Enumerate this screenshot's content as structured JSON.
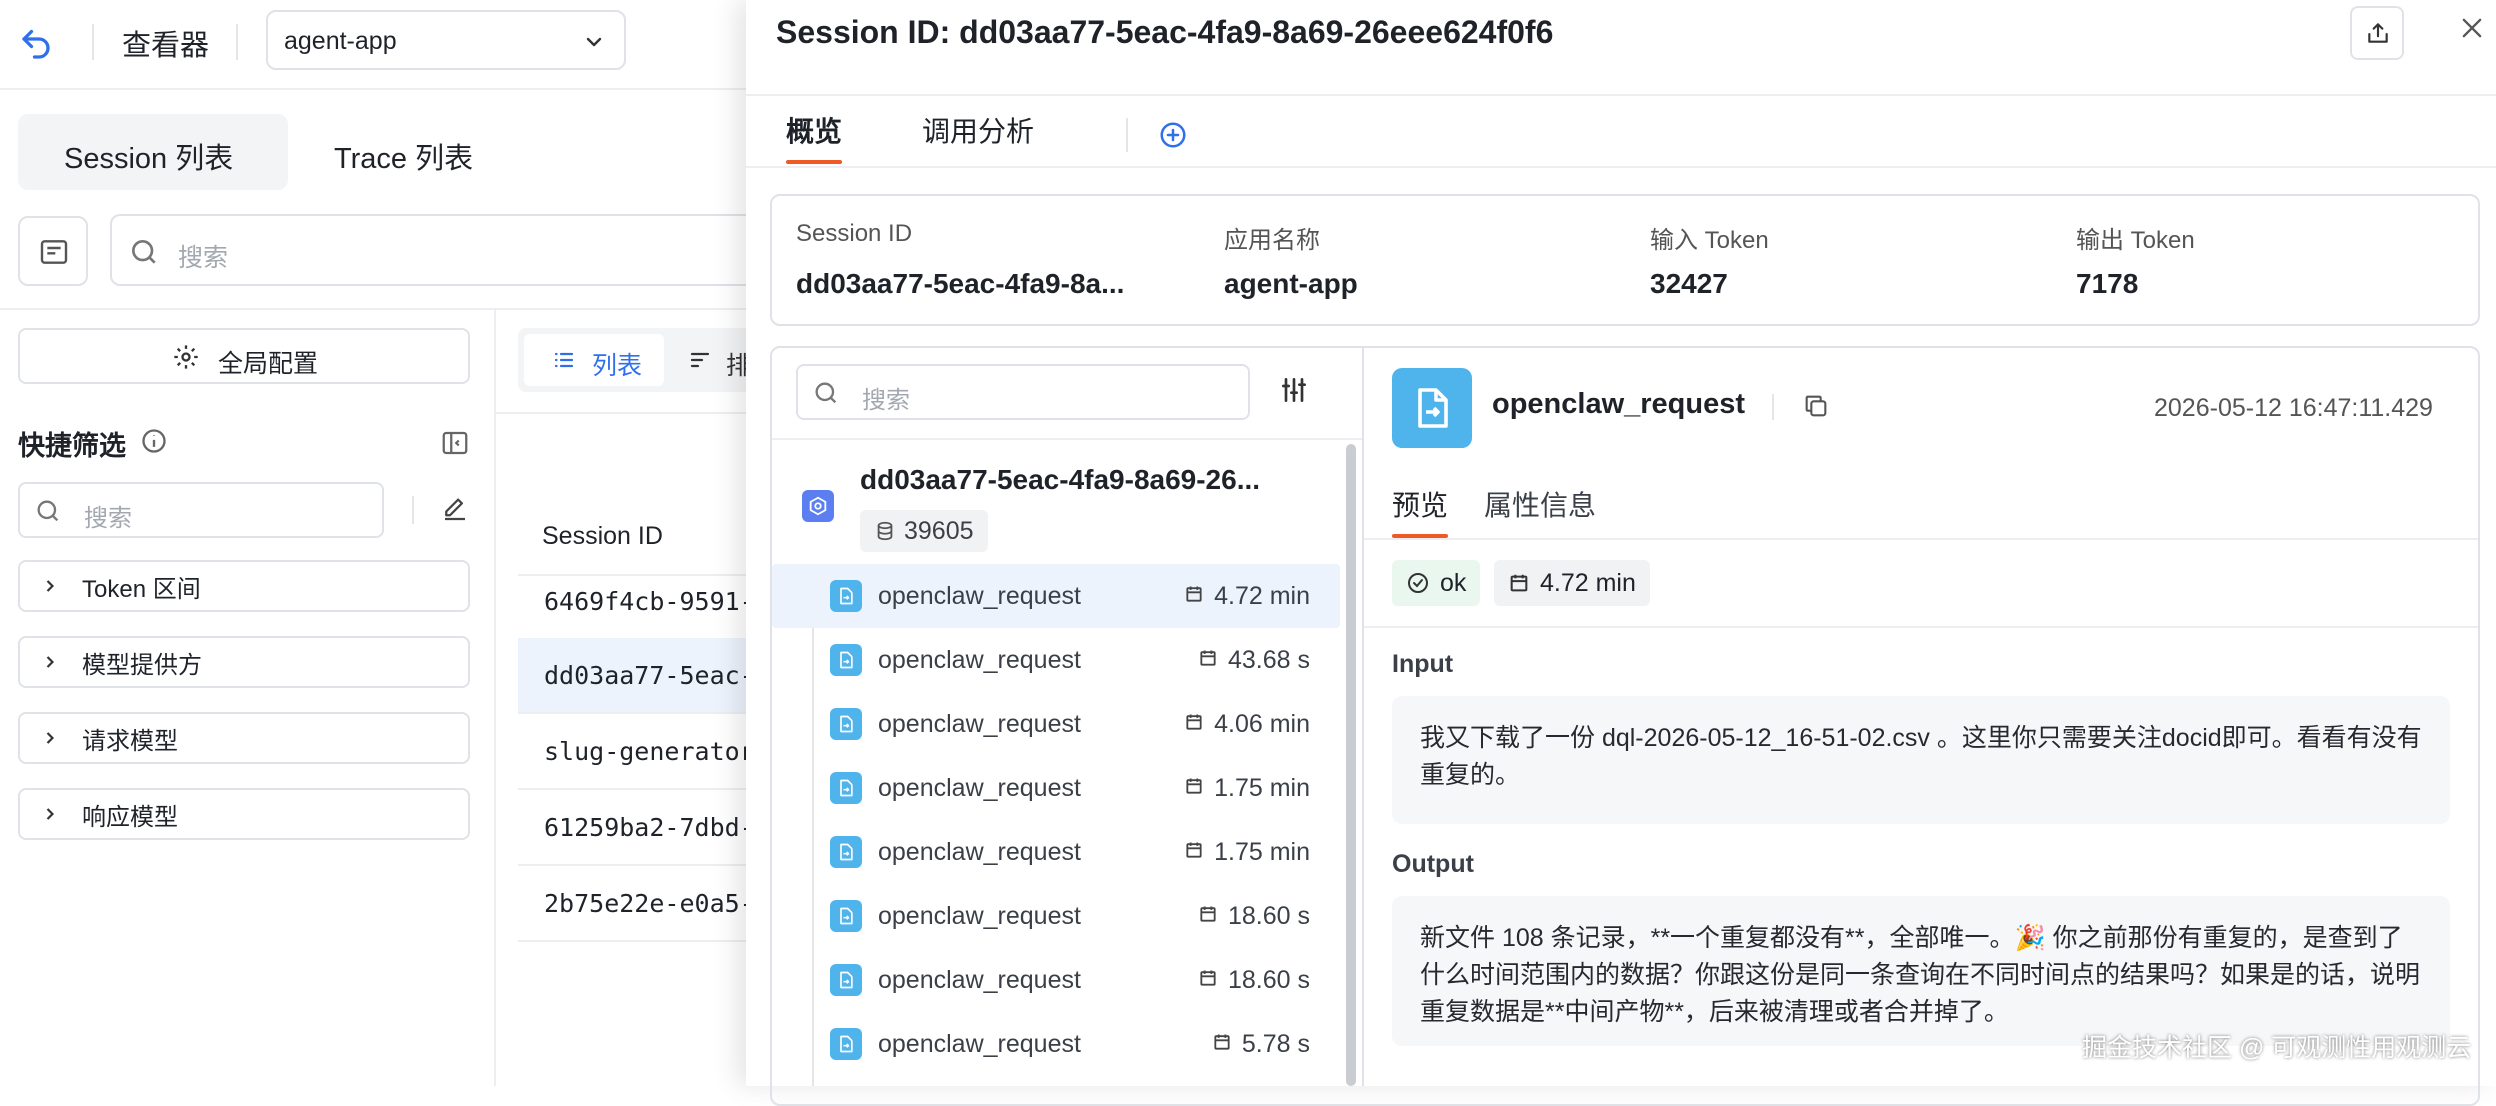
{
  "app": {
    "title": "查看器",
    "app_select": "agent-app"
  },
  "tabs": [
    "Session 列表",
    "Trace 列表"
  ],
  "search_placeholder": "搜索",
  "global_config": "全局配置",
  "quick_filter": {
    "title": "快捷筛选",
    "search_placeholder": "搜索",
    "items": [
      "Token 区间",
      "模型提供方",
      "请求模型",
      "响应模型"
    ]
  },
  "view_modes": {
    "list": "列表",
    "other_partial": "排"
  },
  "sessions": {
    "column": "Session ID",
    "rows": [
      "6469f4cb-9591-",
      "dd03aa77-5eac-",
      "slug-generator",
      "61259ba2-7dbd-",
      "2b75e22e-e0a5-"
    ]
  },
  "drawer": {
    "title": "Session ID: dd03aa77-5eac-4fa9-8a69-26eee624f0f6",
    "tabs": [
      "概览",
      "调用分析"
    ],
    "summary": [
      {
        "label": "Session ID",
        "value": "dd03aa77-5eac-4fa9-8a..."
      },
      {
        "label": "应用名称",
        "value": "agent-app"
      },
      {
        "label": "输入 Token",
        "value": "32427"
      },
      {
        "label": "输出 Token",
        "value": "7178"
      }
    ],
    "tree_search_placeholder": "搜索",
    "root": {
      "name": "dd03aa77-5eac-4fa9-8a69-26...",
      "count": "39605"
    },
    "spans": [
      {
        "name": "openclaw_request",
        "duration": "4.72 min"
      },
      {
        "name": "openclaw_request",
        "duration": "43.68 s"
      },
      {
        "name": "openclaw_request",
        "duration": "4.06 min"
      },
      {
        "name": "openclaw_request",
        "duration": "1.75 min"
      },
      {
        "name": "openclaw_request",
        "duration": "1.75 min"
      },
      {
        "name": "openclaw_request",
        "duration": "18.60 s"
      },
      {
        "name": "openclaw_request",
        "duration": "18.60 s"
      },
      {
        "name": "openclaw_request",
        "duration": "5.78 s"
      }
    ],
    "detail": {
      "name": "openclaw_request",
      "timestamp": "2026-05-12 16:47:11.429",
      "tabs": [
        "预览",
        "属性信息"
      ],
      "status": "ok",
      "duration": "4.72 min",
      "input_label": "Input",
      "input_text": "我又下载了一份 dql-2026-05-12_16-51-02.csv 。这里你只需要关注docid即可。看看有没有重复的。",
      "output_label": "Output",
      "output_text": "新文件 108 条记录，**一个重复都没有**，全部唯一。🎉 你之前那份有重复的，是查到了什么时间范围内的数据？你跟这份是同一条查询在不同时间点的结果吗？如果是的话，说明重复数据是**中间产物**，后来被清理或者合并掉了。"
    }
  },
  "watermark": "掘金技术社区 @ 可观测性用观测云"
}
